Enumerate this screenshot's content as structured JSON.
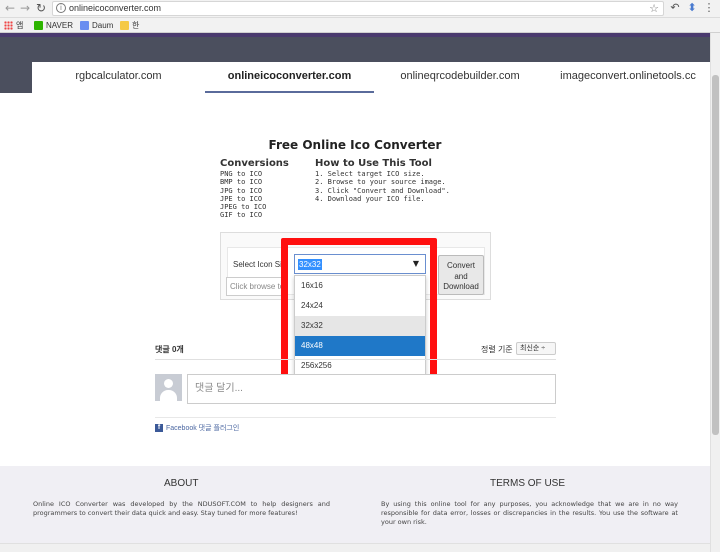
{
  "browser": {
    "url": "onlineicoconverter.com",
    "bookmarks": [
      "앱",
      "NAVER",
      "Daum",
      "한"
    ]
  },
  "nav": {
    "tabs": [
      {
        "label": "rgbcalculator.com",
        "active": false
      },
      {
        "label": "onlineicoconverter.com",
        "active": true
      },
      {
        "label": "onlineqrcodebuilder.com",
        "active": false
      },
      {
        "label": "imageconvert.onlinetools.cc",
        "active": false
      }
    ]
  },
  "main": {
    "title": "Free Online Ico Converter",
    "conversions_heading": "Conversions",
    "conversions": [
      "PNG to ICO",
      "BMP to ICO",
      "JPG to ICO",
      "JPE to ICO",
      "JPEG to ICO",
      "GIF to ICO"
    ],
    "howto_heading": "How to Use This Tool",
    "howto": [
      "1. Select target ICO size.",
      "2. Browse to your source image.",
      "3. Click \"Convert and Download\".",
      "4. Download your ICO file."
    ]
  },
  "tool": {
    "select_label": "Select Icon Si",
    "file_placeholder": "Click browse to",
    "convert_label_1": "Convert",
    "convert_label_2": "and",
    "convert_label_3": "Download",
    "selected_value": "32x32",
    "options": [
      {
        "label": "16x16",
        "state": "normal"
      },
      {
        "label": "24x24",
        "state": "normal"
      },
      {
        "label": "32x32",
        "state": "hover"
      },
      {
        "label": "48x48",
        "state": "selected"
      },
      {
        "label": "256x256",
        "state": "normal"
      }
    ]
  },
  "comments": {
    "count_label": "댓글 0개",
    "sort_label": "정렬 기준",
    "sort_value": "최신순 ÷",
    "placeholder": "댓글 달기...",
    "plugin_label": "Facebook 댓글 플러그인"
  },
  "footer": {
    "about_heading": "ABOUT",
    "about_text": "Online ICO Converter was developed by the NDUSOFT.COM to help designers and programmers to convert their data quick and easy. Stay tuned for more features!",
    "terms_heading": "TERMS OF USE",
    "terms_text": "By using this online tool for any purposes, you acknowledge that we are in no way responsible for data error, losses or discrepancies in the results. You use the software at your own risk."
  },
  "colors": {
    "accent_red": "#ff1010",
    "selected_blue": "#1f78c8",
    "header_dark": "#4b4f5e"
  }
}
